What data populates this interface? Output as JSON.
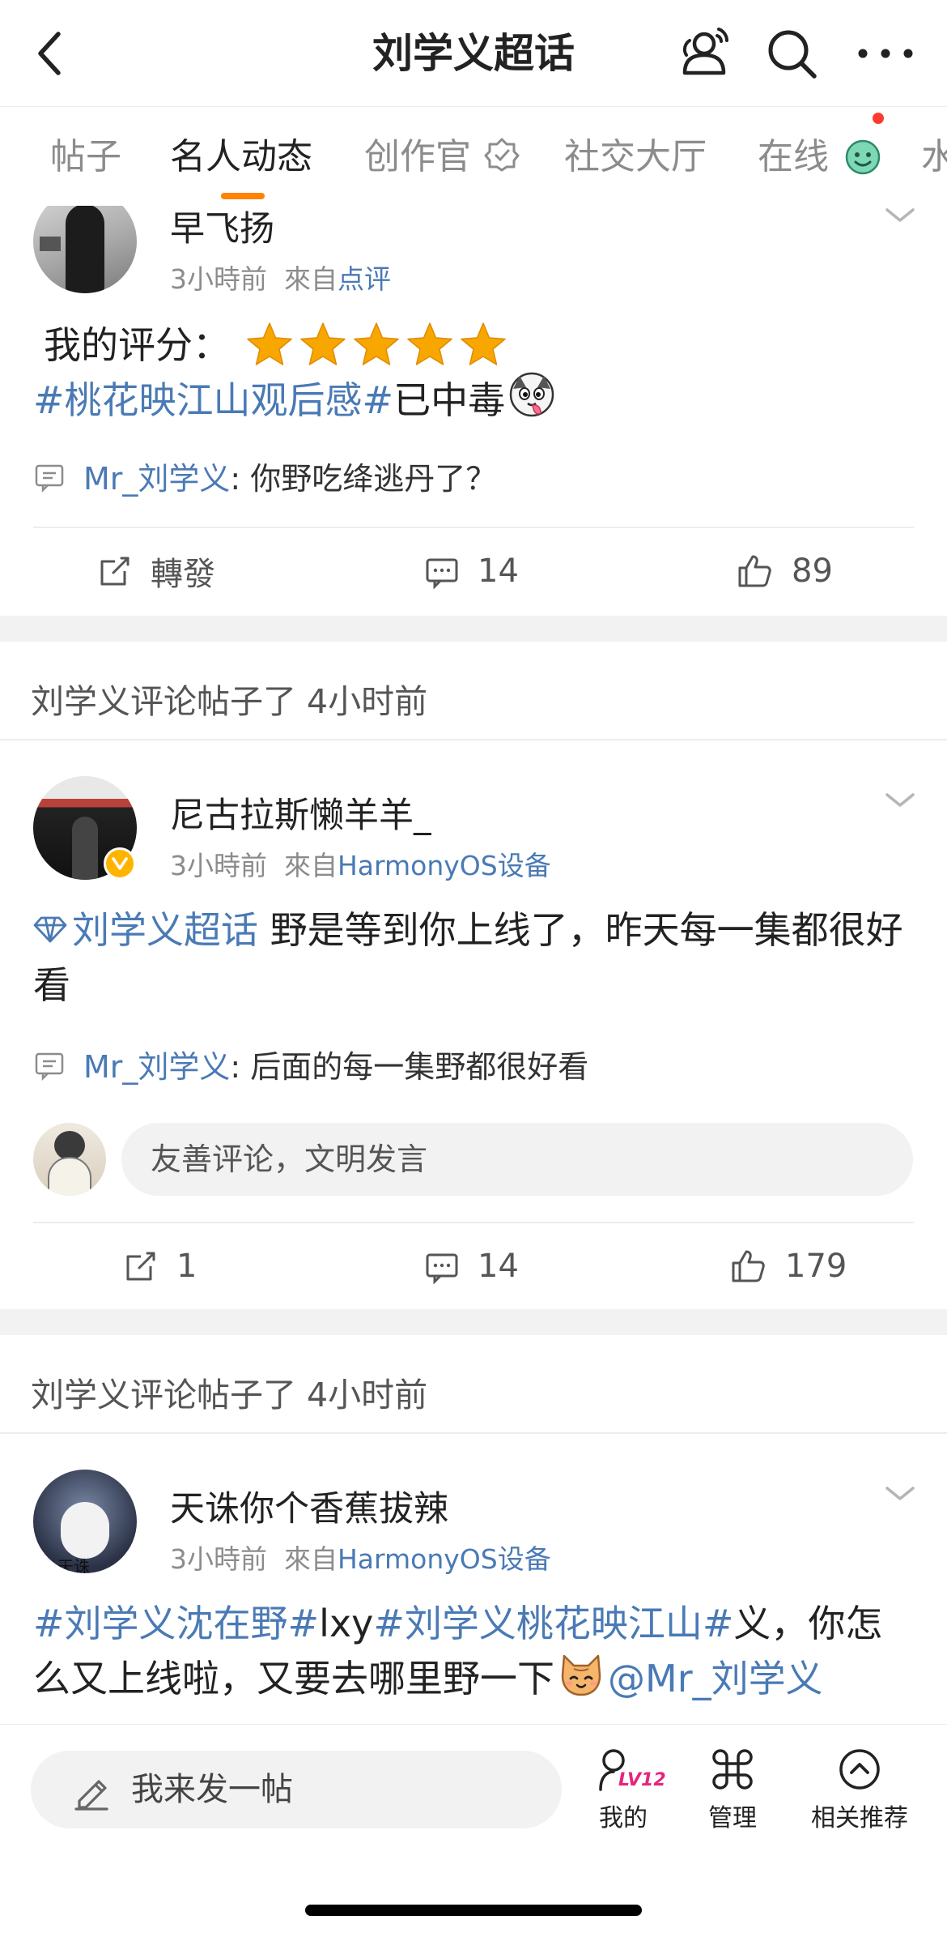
{
  "navbar": {
    "title": "刘学义超话",
    "back_icon": "chevron-left-icon",
    "chat_icon": "group-chat-icon",
    "search_icon": "search-icon",
    "more_icon": "more-icon"
  },
  "tabs": [
    {
      "label": "帖子",
      "active": false
    },
    {
      "label": "名人动态",
      "active": true
    },
    {
      "label": "创作官",
      "active": false,
      "icon": "badge-icon"
    },
    {
      "label": "社交大厅",
      "active": false
    },
    {
      "label": "在线",
      "active": false,
      "icon": "green-emoji-icon",
      "dot": true
    },
    {
      "label": "水",
      "active": false
    }
  ],
  "posts": [
    {
      "name": "早飞扬",
      "time": "3小時前",
      "source_prefix": "來自",
      "source": "点评",
      "rating_label": "我的评分：",
      "stars": 5,
      "text": [
        {
          "t": "#桃花映江山观后感#",
          "tag": true
        },
        {
          "t": "已中毒",
          "tag": false
        }
      ],
      "text_emoji": "dog-tongue-emoji",
      "reply_user": "Mr_刘学义",
      "reply_text": ": 你野吃绛逃丹了？",
      "actions": {
        "repost": "轉發",
        "comments": "14",
        "likes": "89"
      }
    },
    {
      "section": "刘学义评论帖子了 4小时前",
      "name": "尼古拉斯懒羊羊_",
      "time": "3小時前",
      "source_prefix": "來自",
      "source": "HarmonyOS设备",
      "verified_badge": "v-badge-icon",
      "text": [
        {
          "t": "刘学义超话",
          "tag": true
        },
        {
          "t": " 野是等到你上线了，昨天每一集都很好看",
          "tag": false
        }
      ],
      "text_icon": "diamond-icon",
      "reply_user": "Mr_刘学义",
      "reply_text": ": 后面的每一集野都很好看",
      "comment_placeholder": "友善评论，文明发言",
      "actions": {
        "repost": "1",
        "comments": "14",
        "likes": "179"
      }
    },
    {
      "section": "刘学义评论帖子了 4小时前",
      "name": "天诛你个香蕉拔辣",
      "time": "3小時前",
      "source_prefix": "來自",
      "source": "HarmonyOS设备",
      "avatar_caption": "天诛",
      "text": [
        {
          "t": "#刘学义沈在野#",
          "tag": true
        },
        {
          "t": "lxy",
          "tag": false
        },
        {
          "t": "#刘学义桃花映江山#",
          "tag": true
        },
        {
          "t": "义，你怎么又上线啦，又要去哪里野一下",
          "tag": false
        }
      ],
      "text_emoji": "cat-emoji",
      "mention": "@Mr_刘学义"
    }
  ],
  "bottombar": {
    "compose_placeholder": "我来发一帖",
    "compose_icon": "pencil-icon",
    "tabs": [
      {
        "label": "我的",
        "icon": "user-level-icon",
        "badge": "LV12"
      },
      {
        "label": "管理",
        "icon": "command-icon"
      },
      {
        "label": "相关推荐",
        "icon": "circle-up-icon"
      }
    ]
  },
  "colors": {
    "accent_orange": "#FF8200",
    "link_blue": "#4A7AB5",
    "star_yellow": "#F7A700",
    "badge_pink": "#E8247A",
    "red_dot": "#FF3B30",
    "separator_gray": "#F2F2F2"
  }
}
